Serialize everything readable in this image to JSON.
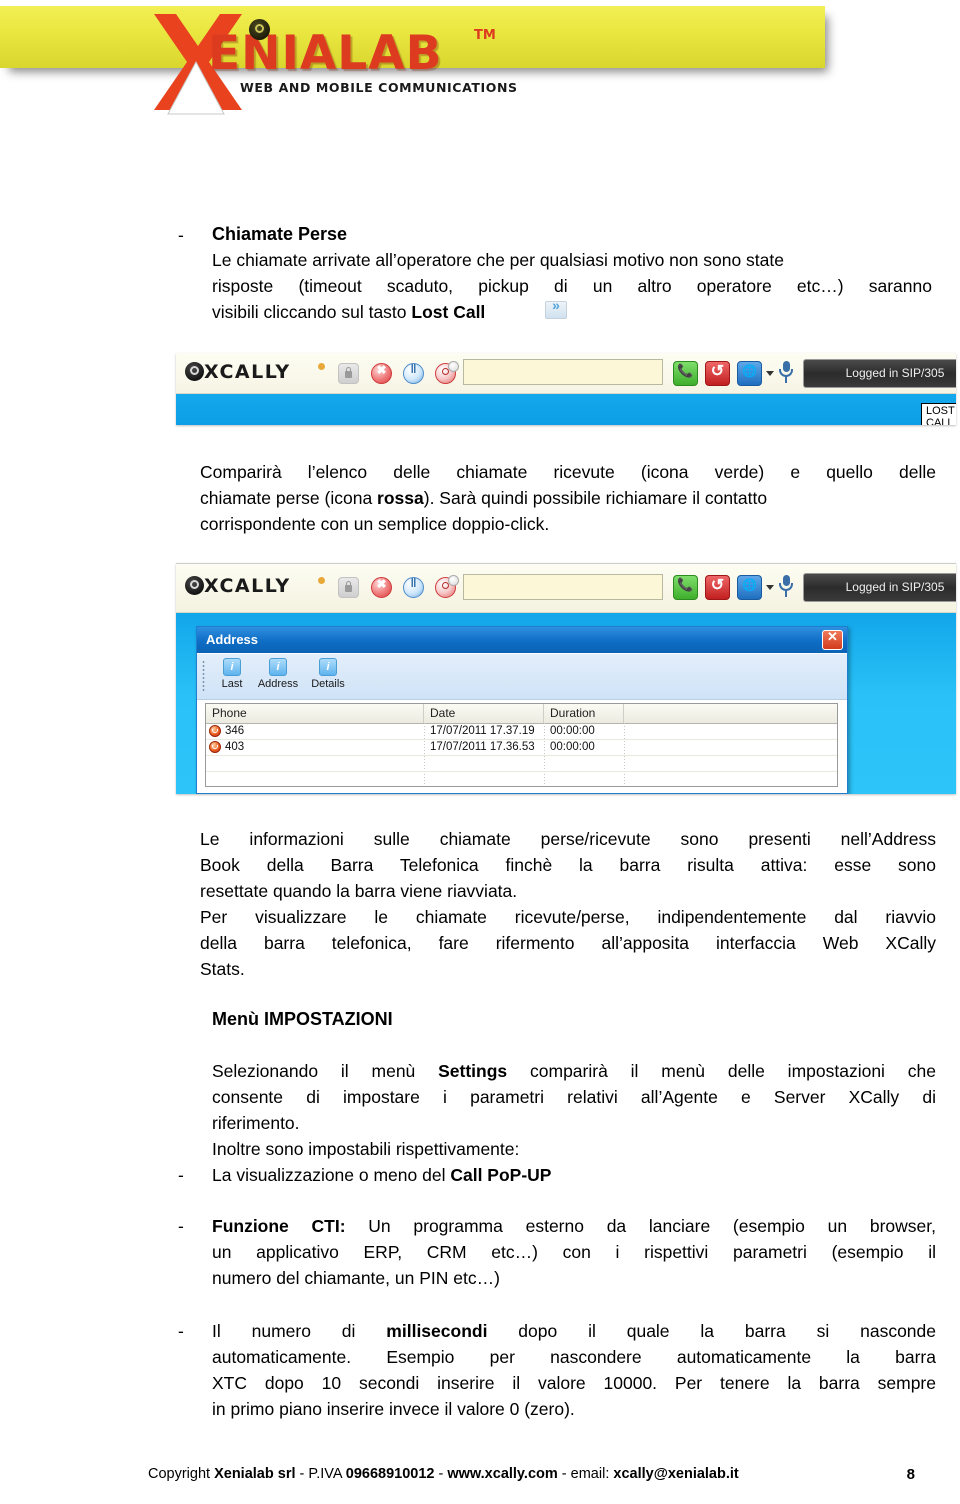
{
  "header": {
    "logo_word": "ENIALAB",
    "logo_tm": "TM",
    "logo_tagline": "WEB AND MOBILE COMMUNICATIONS"
  },
  "section1": {
    "dash": "-",
    "heading": "Chiamate Perse",
    "para_line1": "Le chiamate arrivate all’operatore che per qualsiasi motivo non sono state",
    "para_line2": "risposte (timeout scaduto, pickup di un altro operatore etc…) saranno",
    "para_line3_pre": "visibili cliccando sul tasto ",
    "para_line3_bold": "Lost Call"
  },
  "toolbar_shot": {
    "brand": "XCALLY",
    "input_value": "",
    "status_label": "Logged in SIP/305",
    "lost_call_tooltip": "LOST CALL",
    "icons": [
      "lock-icon",
      "hangup-icon",
      "pause-icon",
      "agent-status-icon",
      "call-icon",
      "transfer-icon",
      "web-icon",
      "mic-icon",
      "lost-call-icon"
    ]
  },
  "para2": {
    "line1_a": "Comparirà l’elenco delle chiamate ricevute (icona verde) e quello delle",
    "line2_a": "chiamate perse (icona ",
    "line2_b": "rossa",
    "line2_c": "). Sarà quindi possibile richiamare il contatto",
    "line3": "corrispondente con un semplice doppio-click."
  },
  "address_shot": {
    "brand": "XCALLY",
    "status_label": "Logged in SIP/305",
    "window_title": "Address",
    "toolbar_buttons": [
      {
        "label": "Last",
        "glyph": "i"
      },
      {
        "label": "Address",
        "glyph": "i"
      },
      {
        "label": "Details",
        "glyph": "i"
      }
    ],
    "columns": [
      "Phone",
      "Date",
      "Duration"
    ],
    "rows": [
      {
        "phone": "346",
        "date": "17/07/2011 17.37.19",
        "duration": "00:00:00"
      },
      {
        "phone": "403",
        "date": "17/07/2011 17.36.53",
        "duration": "00:00:00"
      }
    ]
  },
  "para3": {
    "line1": "Le informazioni sulle chiamate perse/ricevute sono presenti nell’Address",
    "line2": "Book della Barra Telefonica finchè la barra risulta attiva: esse sono",
    "line3": "resettate quando la barra viene riavviata.",
    "line4": "Per visualizzare le chiamate ricevute/perse, indipendentemente dal riavvio",
    "line5": "della barra telefonica, fare rifermento all’apposita interfaccia Web XCally",
    "line6": "Stats."
  },
  "settings": {
    "heading": "Menù IMPOSTAZIONI",
    "line1_a": "Selezionando il menù ",
    "line1_b": "Settings",
    "line1_c": " comparirà il menù delle impostazioni che",
    "line2": "consente di impostare i parametri relativi all’Agente e Server XCally di",
    "line3": "riferimento.",
    "line4": "Inoltre sono impostabili rispettivamente:",
    "bullet1_dash": "-",
    "bullet1_a": "La visualizzazione o meno del ",
    "bullet1_b": "Call PoP-UP"
  },
  "cti": {
    "dash": "-",
    "line1_bold": "Funzione CTI:",
    "line1_rest": " Un programma esterno da lanciare (esempio un browser,",
    "line2": "un applicativo ERP, CRM etc…) con i rispettivi parametri (esempio il",
    "line3": "numero del chiamante, un PIN etc…)"
  },
  "millis": {
    "dash": "-",
    "line1_a": "Il numero di ",
    "line1_b": "millisecondi",
    "line1_c": " dopo il quale la barra si nasconde",
    "line2": "automaticamente. Esempio per nascondere automaticamente la barra",
    "line3": "XTC dopo 10 secondi inserire il valore 10000. Per tenere la barra sempre",
    "line4": "in primo piano inserire invece il valore 0 (zero)."
  },
  "footer": {
    "copyright_pre": "Copyright ",
    "company": "Xenialab srl",
    "piva_label": " - P.IVA ",
    "piva": "09668910012",
    "sep1": " - ",
    "website": "www.xcally.com",
    "email_label": " - email: ",
    "email": "xcally@xenialab.it",
    "page_number": "8"
  },
  "colors": {
    "banner_yellow": "#e9e63f",
    "logo_red": "#dd3b20",
    "bar_blue": "#14a8ec",
    "window_blue": "#0e6dc4",
    "link_blue": "#1414d6"
  }
}
